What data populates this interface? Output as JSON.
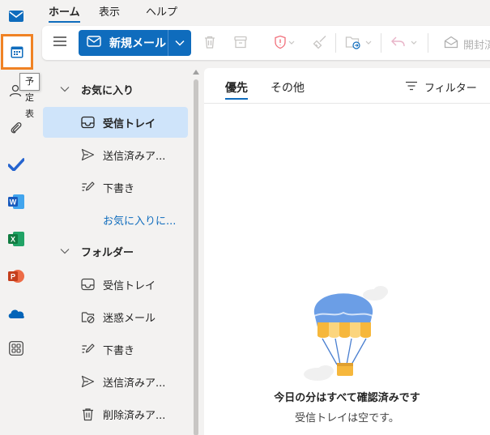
{
  "rail": {
    "items": [
      {
        "icon": "mail-icon"
      },
      {
        "icon": "calendar-icon"
      },
      {
        "icon": "people-icon"
      },
      {
        "icon": "paperclip-icon"
      },
      {
        "icon": "todo-check-icon"
      },
      {
        "icon": "word-icon"
      },
      {
        "icon": "excel-icon"
      },
      {
        "icon": "powerpoint-icon"
      },
      {
        "icon": "onedrive-icon"
      },
      {
        "icon": "apps-grid-icon"
      }
    ],
    "tooltip": "予定表"
  },
  "menu": {
    "tabs": [
      "ホーム",
      "表示",
      "ヘルプ"
    ],
    "selected_tab": "ホーム"
  },
  "ribbon": {
    "new_mail_label": "新規メール",
    "open_label": "開封済"
  },
  "folders": {
    "favorites_header": "お気に入り",
    "favorites": [
      {
        "label": "受信トレイ",
        "icon": "inbox-icon",
        "selected": true
      },
      {
        "label": "送信済みア...",
        "icon": "sent-icon"
      },
      {
        "label": "下書き",
        "icon": "draft-icon"
      }
    ],
    "add_favorite_link": "お気に入りに...",
    "folders_header": "フォルダー",
    "folders": [
      {
        "label": "受信トレイ",
        "icon": "inbox-icon"
      },
      {
        "label": "迷惑メール",
        "icon": "junk-icon"
      },
      {
        "label": "下書き",
        "icon": "draft-icon"
      },
      {
        "label": "送信済みア...",
        "icon": "sent-icon"
      },
      {
        "label": "削除済みア...",
        "icon": "trash-icon"
      }
    ]
  },
  "list": {
    "tabs": [
      "優先",
      "その他"
    ],
    "selected_tab": "優先",
    "filter_label": "フィルター",
    "empty_title": "今日の分はすべて確認済みです",
    "empty_subtitle": "受信トレイは空です。"
  },
  "colors": {
    "accent": "#0f6cbd",
    "highlight_box": "#f08224",
    "selected_bg": "#cfe4fa"
  }
}
